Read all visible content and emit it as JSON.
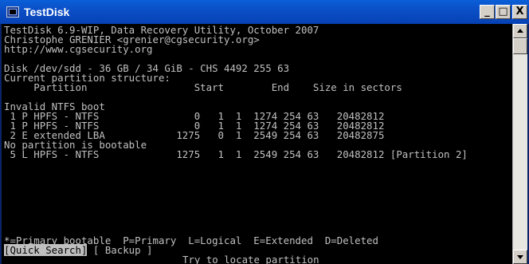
{
  "window": {
    "title": "TestDisk",
    "minimize": "_",
    "maximize": "□",
    "close": "X"
  },
  "console": {
    "header": [
      "TestDisk 6.9-WIP, Data Recovery Utility, October 2007",
      "Christophe GRENIER <grenier@cgsecurity.org>",
      "http://www.cgsecurity.org"
    ],
    "disk_info": "Disk /dev/sdd - 36 GB / 34 GiB - CHS 4492 255 63",
    "structure_title": "Current partition structure:",
    "columns": "     Partition                  Start        End    Size in sectors",
    "messages": {
      "invalid_ntfs": "Invalid NTFS boot",
      "no_bootable": "No partition is bootable"
    },
    "partitions": [
      " 1 P HPFS - NTFS                0   1  1  1274 254 63   20482812",
      " 1 P HPFS - NTFS                0   1  1  1274 254 63   20482812",
      " 2 E extended LBA            1275   0  1  2549 254 63   20482875",
      " 5 L HPFS - NTFS             1275   1  1  2549 254 63   20482812 [Partition 2]"
    ],
    "legend": "*=Primary bootable  P=Primary  L=Logical  E=Extended  D=Deleted",
    "menu": {
      "quick_search": "[Quick Search]",
      "backup": " [ Backup ]"
    },
    "status": "Try to locate partition_"
  }
}
